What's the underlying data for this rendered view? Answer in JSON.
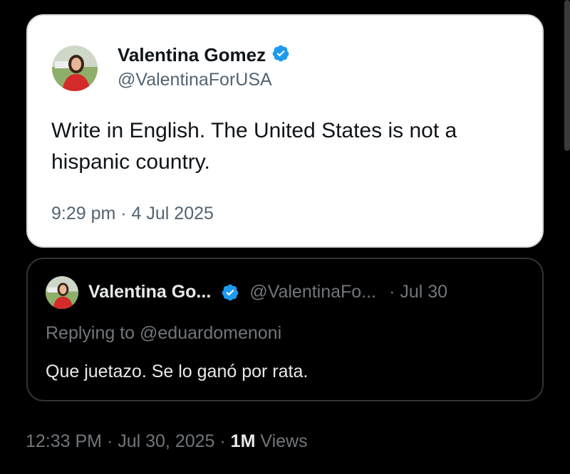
{
  "tweet": {
    "display_name": "Valentina Gomez",
    "handle": "@ValentinaForUSA",
    "text": "Write in English. The United States is not a hispanic country.",
    "timestamp": "9:29 pm · 4 Jul 2025",
    "verified_icon": "verified-badge-icon"
  },
  "reply": {
    "display_name": "Valentina Go...",
    "handle": "@ValentinaFo...",
    "date": "· Jul 30",
    "replying_to": "Replying to @eduardomenoni",
    "text": "Que juetazo. Se lo ganó por rata."
  },
  "footer": {
    "time": "12:33 PM · Jul 30, 2025 · ",
    "views_count": "1M",
    "views_label": " Views"
  },
  "colors": {
    "verified": "#1d9bf0",
    "background": "#000000",
    "card_light": "#ffffff"
  }
}
